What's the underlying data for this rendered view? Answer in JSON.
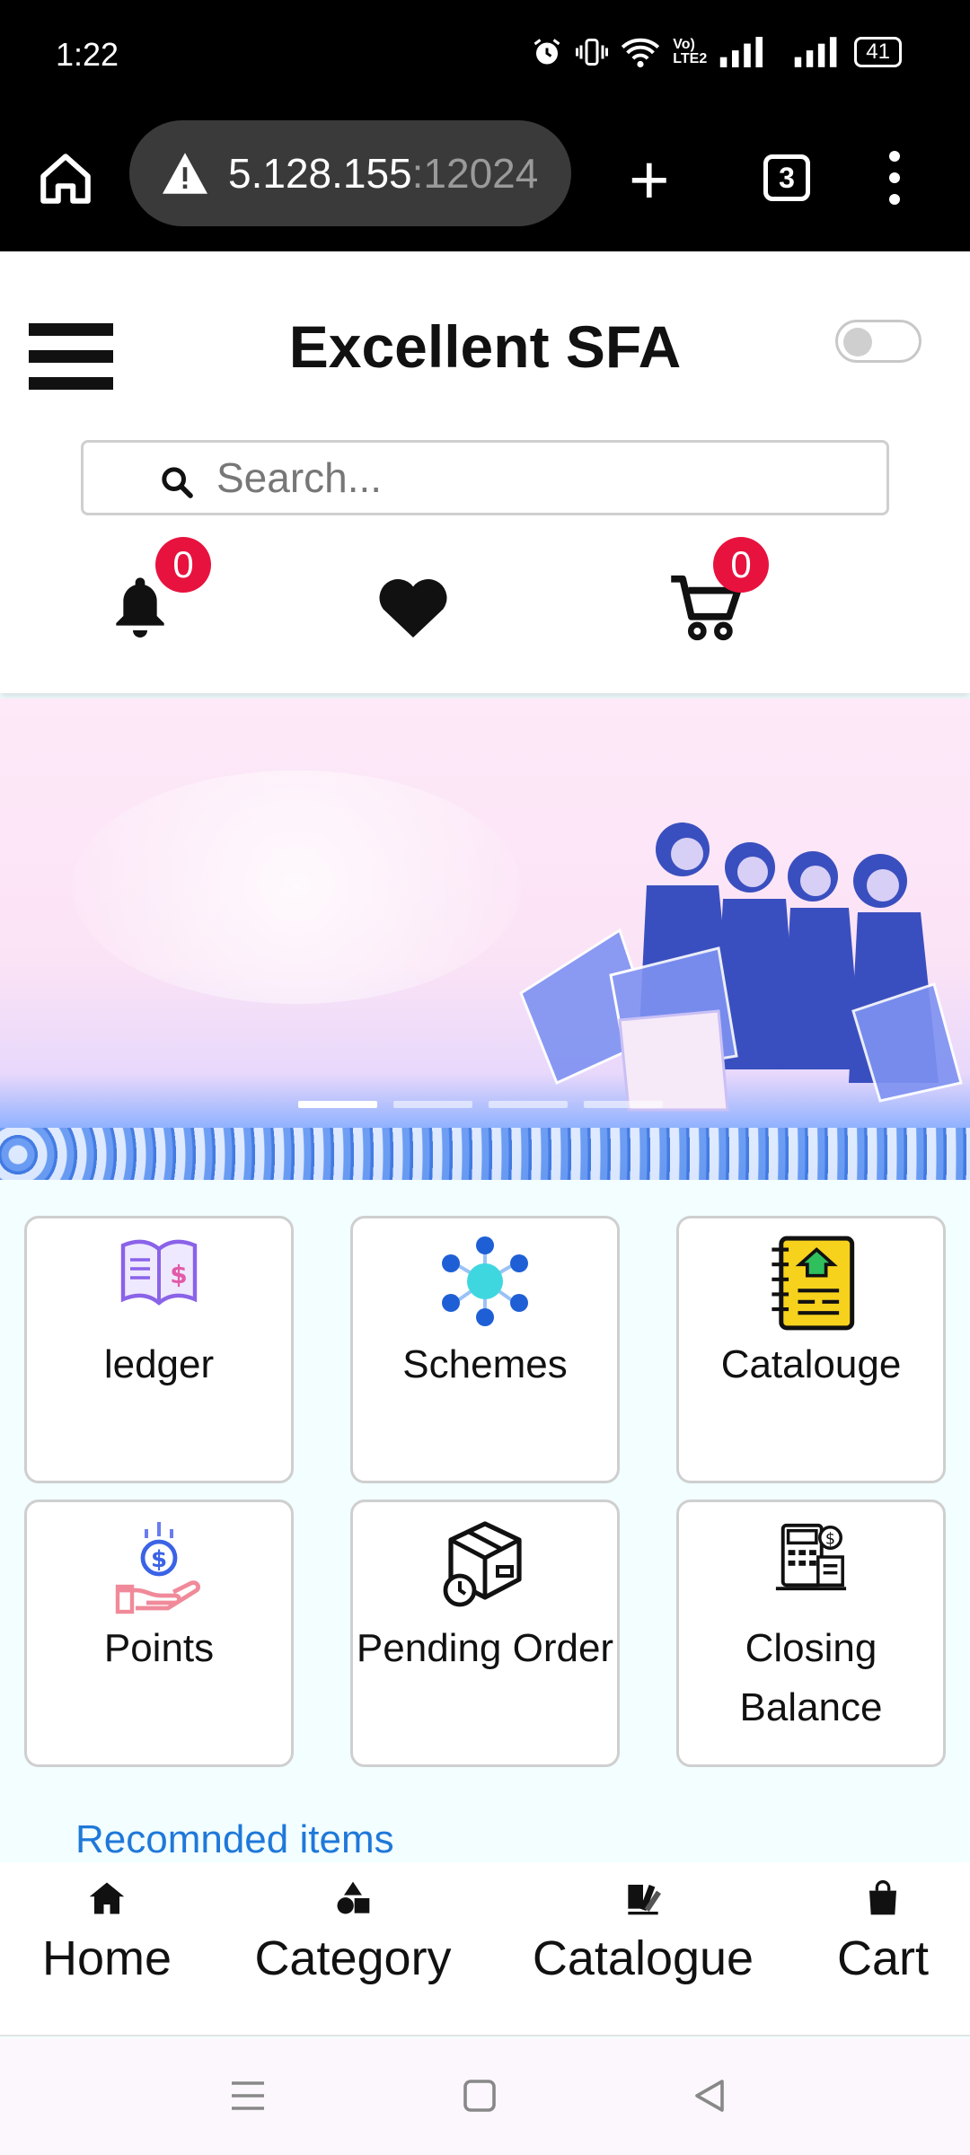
{
  "status": {
    "time": "1:22",
    "battery": "41",
    "network": "Vo) LTE2"
  },
  "browser": {
    "url_host": "5.128.155",
    "url_port": ":12024",
    "tab_count": "3"
  },
  "app": {
    "title": "Excellent SFA",
    "search_placeholder": "Search...",
    "notification_count": "0",
    "cart_count": "0"
  },
  "banner": {
    "slide_count": 4,
    "active_slide": 1
  },
  "tiles": [
    {
      "label": "ledger",
      "icon": "ledger-icon"
    },
    {
      "label": "Schemes",
      "icon": "schemes-icon"
    },
    {
      "label": "Catalouge",
      "icon": "catalogue-book-icon"
    },
    {
      "label": "Points",
      "icon": "points-icon"
    },
    {
      "label": "Pending Order",
      "icon": "pending-order-icon"
    },
    {
      "label": "Closing Balance",
      "icon": "closing-balance-icon"
    }
  ],
  "section": {
    "recommended_title": "Recomnded items"
  },
  "bottom_nav": [
    {
      "label": "Home",
      "icon": "home-icon"
    },
    {
      "label": "Category",
      "icon": "category-icon"
    },
    {
      "label": "Catalogue",
      "icon": "catalogue-icon"
    },
    {
      "label": "Cart",
      "icon": "cart-bag-icon"
    }
  ],
  "colors": {
    "badge": "#e8123e",
    "accent_link": "#1f78d9",
    "page_bg": "#f2feff"
  }
}
